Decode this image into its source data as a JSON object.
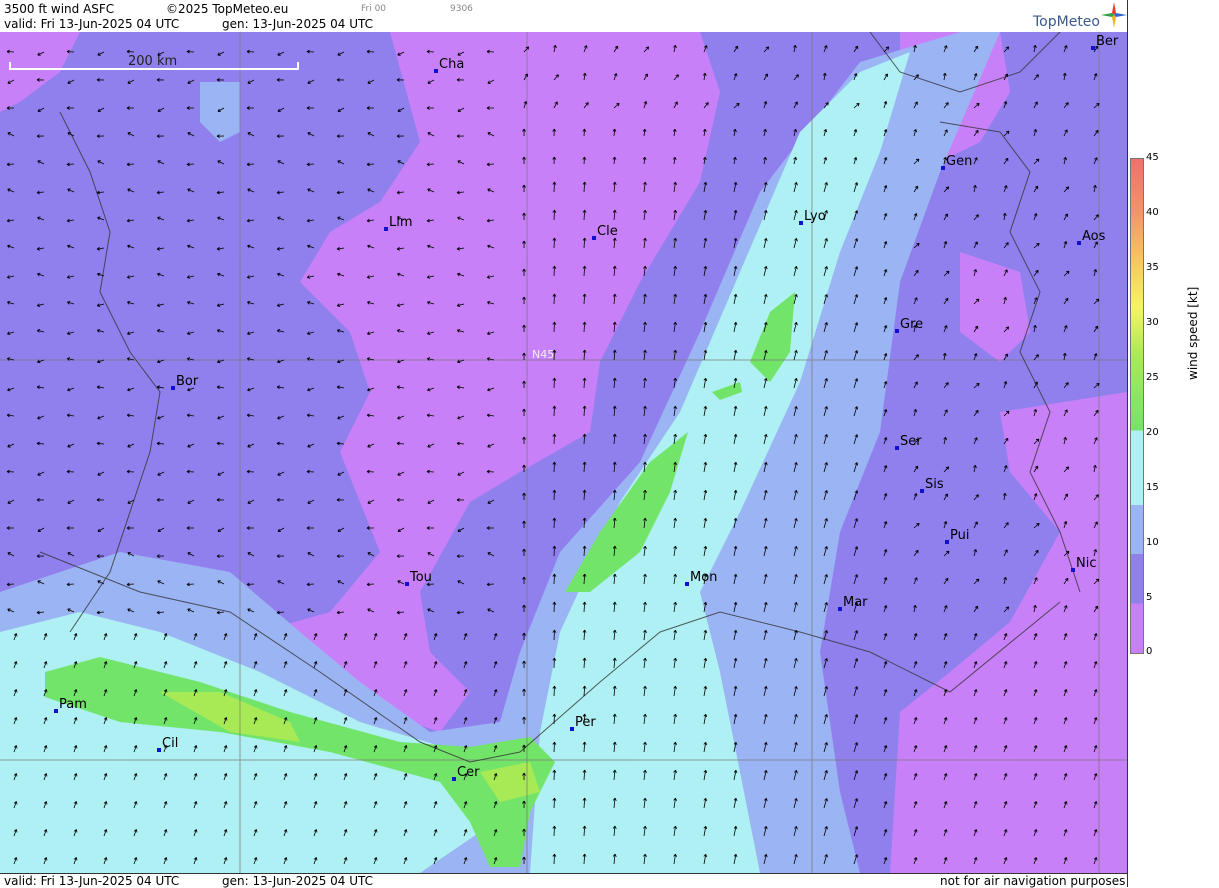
{
  "header": {
    "product": "3500 ft wind ASFC",
    "copyright": "©2025 TopMeteo.eu",
    "frame": "Fri 00",
    "code": "9306",
    "valid": "valid:  Fri  13-Jun-2025  04 UTC",
    "gen": "gen: 13-Jun-2025 04 UTC",
    "logo": "TopMeteo"
  },
  "map": {
    "scale_label": "200 km",
    "lat_label": "N45",
    "cities": [
      {
        "name": "Cha"
      },
      {
        "name": "Ber"
      },
      {
        "name": "Gen"
      },
      {
        "name": "Lim"
      },
      {
        "name": "Cle"
      },
      {
        "name": "Lyo"
      },
      {
        "name": "Aos"
      },
      {
        "name": "Gre"
      },
      {
        "name": "Bor"
      },
      {
        "name": "Ser"
      },
      {
        "name": "Sis"
      },
      {
        "name": "Pui"
      },
      {
        "name": "Tou"
      },
      {
        "name": "Mon"
      },
      {
        "name": "Nic"
      },
      {
        "name": "Mar"
      },
      {
        "name": "Pam"
      },
      {
        "name": "Per"
      },
      {
        "name": "Cil"
      },
      {
        "name": "Cer"
      }
    ]
  },
  "footer": {
    "valid": "valid:  Fri  13-Jun-2025  04 UTC",
    "gen": "gen: 13-Jun-2025 04 UTC",
    "disclaimer": "not for air navigation purposes"
  },
  "legend": {
    "unit": "wind speed [kt]",
    "ticks": [
      "45",
      "40",
      "35",
      "30",
      "25",
      "20",
      "15",
      "10",
      "5",
      "0"
    ],
    "colors": {
      "0-5": "#c880f8",
      "5-10": "#8f80ee",
      "10-15": "#9bb4f3",
      "15-20": "#aef0f3",
      "20-25": "#73e46a",
      "25-30": "#a8ea55",
      "30-35": "#f5f560",
      "35-40": "#f7c45d",
      "40-45": "#f0706a"
    }
  }
}
